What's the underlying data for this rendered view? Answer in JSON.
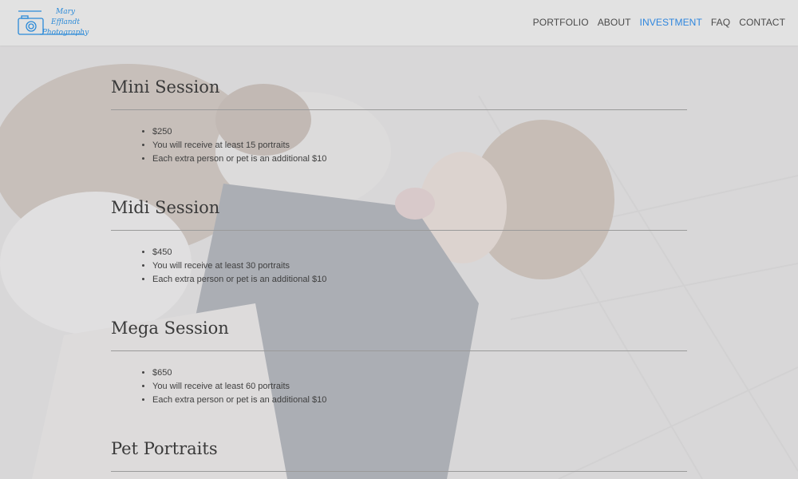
{
  "brand": {
    "line1": "Mary Efflandt",
    "line2": "Photography"
  },
  "nav": [
    {
      "label": "PORTFOLIO",
      "active": false
    },
    {
      "label": "ABOUT",
      "active": false
    },
    {
      "label": "INVESTMENT",
      "active": true
    },
    {
      "label": "FAQ",
      "active": false
    },
    {
      "label": "CONTACT",
      "active": false
    }
  ],
  "sessions": [
    {
      "title": "Mini Session",
      "items": [
        "$250",
        "You will receive at least 15 portraits",
        "Each extra person or pet is an additional $10"
      ]
    },
    {
      "title": "Midi Session",
      "items": [
        "$450",
        "You will receive at least 30 portraits",
        "Each extra person or pet is an additional $10"
      ]
    },
    {
      "title": "Mega Session",
      "items": [
        "$650",
        "You will receive at least 60 portraits",
        "Each extra person or pet is an additional $10"
      ]
    },
    {
      "title": "Pet Portraits",
      "items": []
    }
  ],
  "colors": {
    "accent": "#2e86de",
    "header_bg": "#e2e2e2",
    "text": "#3a3a3a"
  }
}
